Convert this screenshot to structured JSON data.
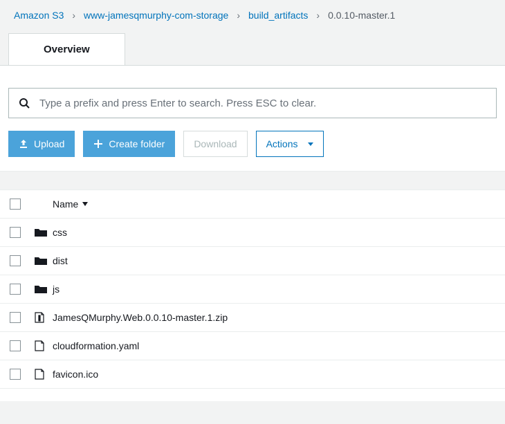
{
  "breadcrumb": {
    "items": [
      {
        "label": "Amazon S3",
        "link": true
      },
      {
        "label": "www-jamesqmurphy-com-storage",
        "link": true
      },
      {
        "label": "build_artifacts",
        "link": true
      },
      {
        "label": "0.0.10-master.1",
        "link": false
      }
    ]
  },
  "tabs": {
    "overview": "Overview"
  },
  "search": {
    "placeholder": "Type a prefix and press Enter to search. Press ESC to clear."
  },
  "toolbar": {
    "upload": "Upload",
    "create_folder": "Create folder",
    "download": "Download",
    "actions": "Actions"
  },
  "table": {
    "header_name": "Name",
    "rows": [
      {
        "type": "folder",
        "name": "css"
      },
      {
        "type": "folder",
        "name": "dist"
      },
      {
        "type": "folder",
        "name": "js"
      },
      {
        "type": "zip",
        "name": "JamesQMurphy.Web.0.0.10-master.1.zip"
      },
      {
        "type": "file",
        "name": "cloudformation.yaml"
      },
      {
        "type": "file",
        "name": "favicon.ico"
      }
    ]
  }
}
